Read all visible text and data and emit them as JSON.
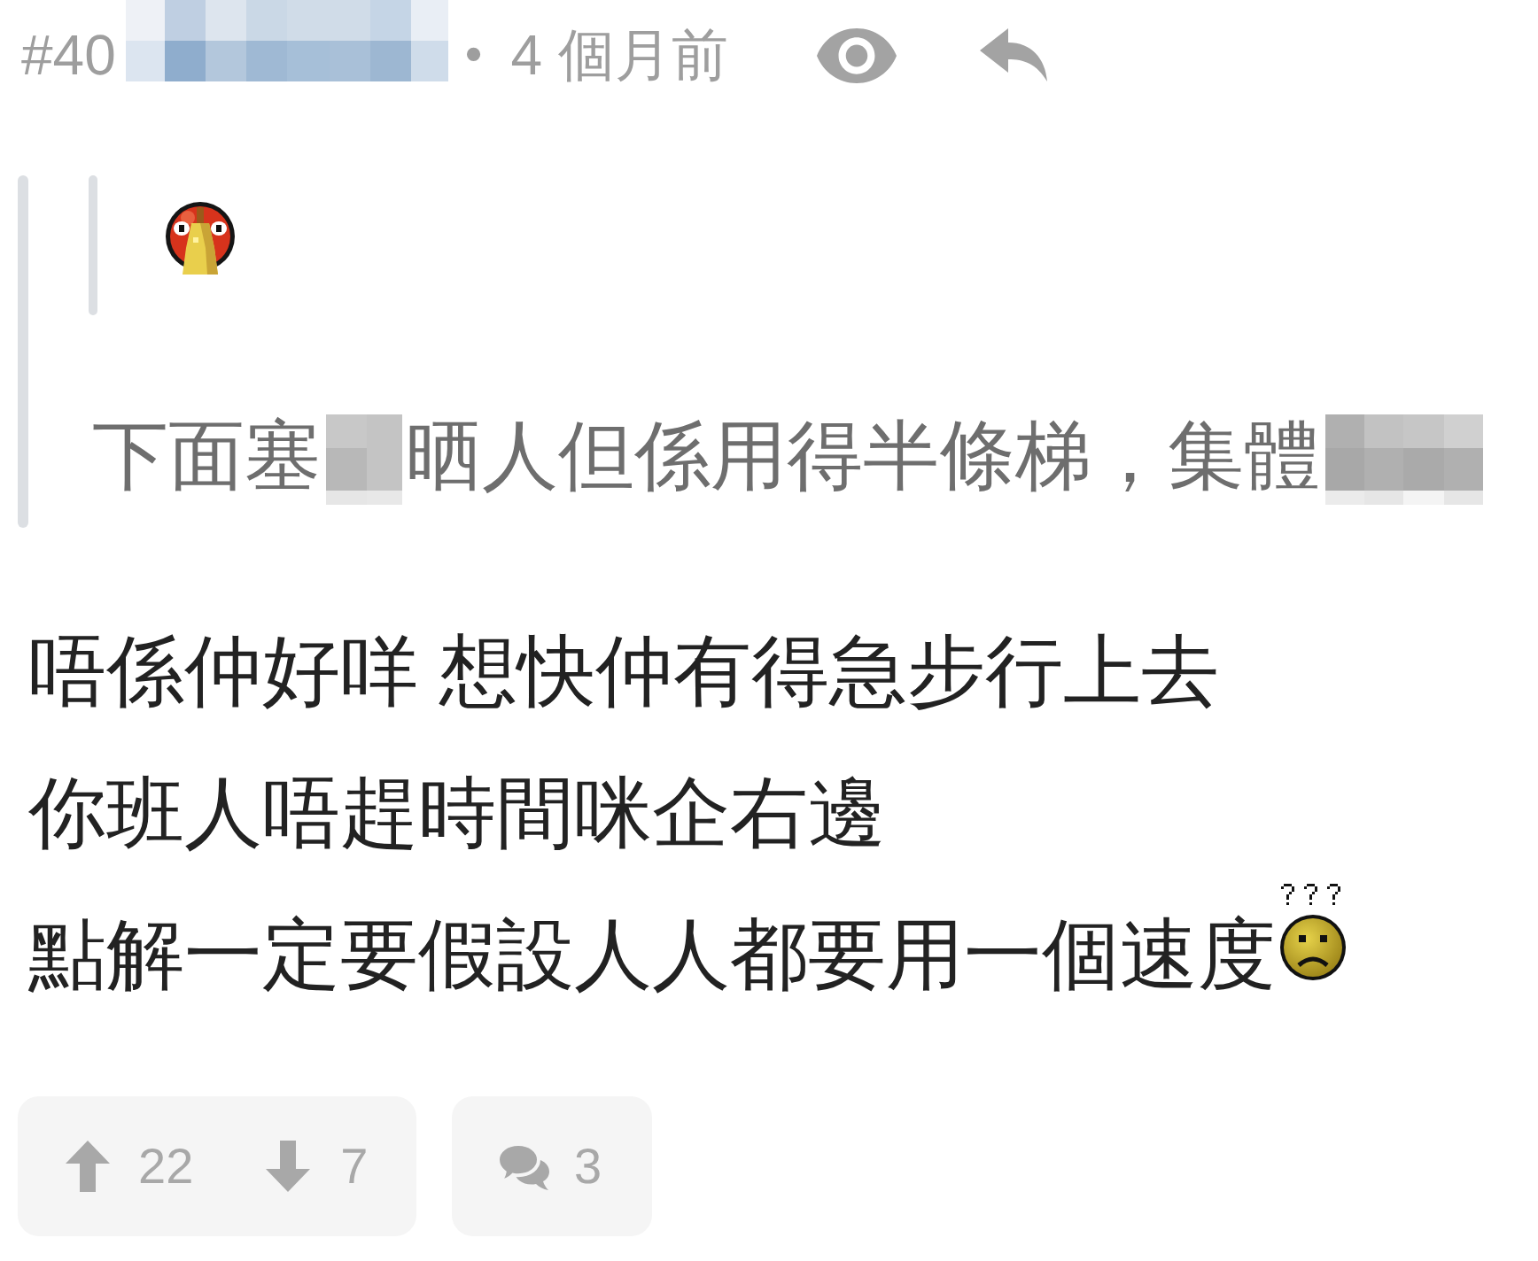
{
  "post": {
    "number": "#40",
    "separator": "•",
    "time": "4 個月前"
  },
  "quote": {
    "segments": [
      {
        "kind": "text",
        "text": "下面塞"
      },
      {
        "kind": "redacted"
      },
      {
        "kind": "text",
        "text": "晒人但係用得半條梯，集體"
      },
      {
        "kind": "redacted"
      }
    ]
  },
  "body": {
    "lines": [
      "唔係仲好咩 想快仲有得急步行上去",
      "你班人唔趕時間咪企右邊",
      "點解一定要假設人人都要用一個速度"
    ]
  },
  "footer": {
    "upvotes": "22",
    "downvotes": "7",
    "comments": "3"
  }
}
